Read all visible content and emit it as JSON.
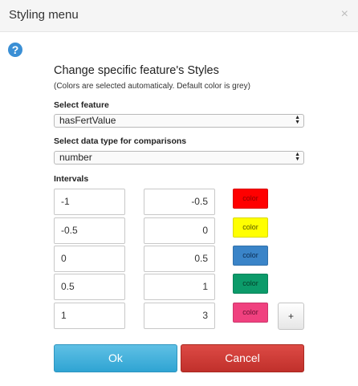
{
  "header": {
    "title": "Styling menu",
    "close_label": "×"
  },
  "help_icon_label": "?",
  "content": {
    "heading": "Change specific feature's Styles",
    "note": "(Colors are selected automaticaly. Default color is grey)",
    "feature_label": "Select feature",
    "feature_value": "hasFertValue",
    "datatype_label": "Select data type for comparisons",
    "datatype_value": "number",
    "intervals_label": "Intervals"
  },
  "intervals": [
    {
      "from": "-1",
      "to": "-0.5",
      "color_label": "color",
      "color": "#ff0000",
      "text_color": "#8b0000"
    },
    {
      "from": "-0.5",
      "to": "0",
      "color_label": "color",
      "color": "#ffff00",
      "text_color": "#555500"
    },
    {
      "from": "0",
      "to": "0.5",
      "color_label": "color",
      "color": "#3a84c8",
      "text_color": "#0c2d52"
    },
    {
      "from": "0.5",
      "to": "1",
      "color_label": "color",
      "color": "#0c9b6a",
      "text_color": "#04402b"
    },
    {
      "from": "1",
      "to": "3",
      "color_label": "color",
      "color": "#f0417f",
      "text_color": "#6a0f33"
    }
  ],
  "add_label": "+",
  "buttons": {
    "ok": "Ok",
    "cancel": "Cancel"
  }
}
